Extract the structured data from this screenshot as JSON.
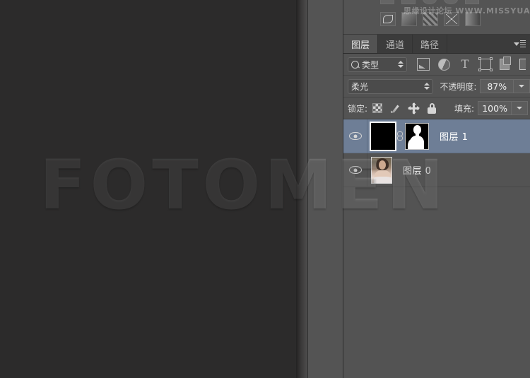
{
  "watermarks": {
    "canvas_text": "FOTOMEN",
    "site_cn": "思缘设计论坛",
    "site_url": "WWW.MISSYUAN.COM"
  },
  "panel": {
    "tabs": [
      {
        "label": "图层",
        "active": true
      },
      {
        "label": "通道",
        "active": false
      },
      {
        "label": "路径",
        "active": false
      }
    ],
    "menu_icon": "panel-menu-icon",
    "filter_row": {
      "kind_label": "类型",
      "search_icon": "search-icon",
      "stepper_icon": "stepper-arrows-icon",
      "icons": [
        "filter-pixel-icon",
        "filter-adjustment-icon",
        "filter-type-icon",
        "filter-shape-icon",
        "filter-smartobject-icon"
      ]
    },
    "blend_row": {
      "blend_mode": "柔光",
      "opacity_label": "不透明度:",
      "opacity_value": "87%",
      "dropdown_icon": "chevron-down-icon"
    },
    "lock_row": {
      "lock_label": "锁定:",
      "lock_icons": [
        "lock-transparency-icon",
        "lock-image-icon",
        "lock-position-icon",
        "lock-all-icon"
      ],
      "fill_label": "填充:",
      "fill_value": "100%",
      "dropdown_icon": "chevron-down-icon"
    },
    "layers": [
      {
        "name": "图层 1",
        "visible": true,
        "selected": true,
        "thumbnail": "black-fill-thumbnail",
        "has_link": true,
        "has_mask": true,
        "mask_thumbnail": "white-silhouette-mask"
      },
      {
        "name": "图层 0",
        "visible": true,
        "selected": false,
        "thumbnail": "portrait-photo-thumbnail",
        "has_link": false,
        "has_mask": false
      }
    ]
  },
  "colors": {
    "canvas_bg": "#2c2b2b",
    "panel_bg": "#535353",
    "tab_bar_bg": "#3b3b3b",
    "selected_row": "#6e7e96",
    "text": "#e0e0e0"
  }
}
